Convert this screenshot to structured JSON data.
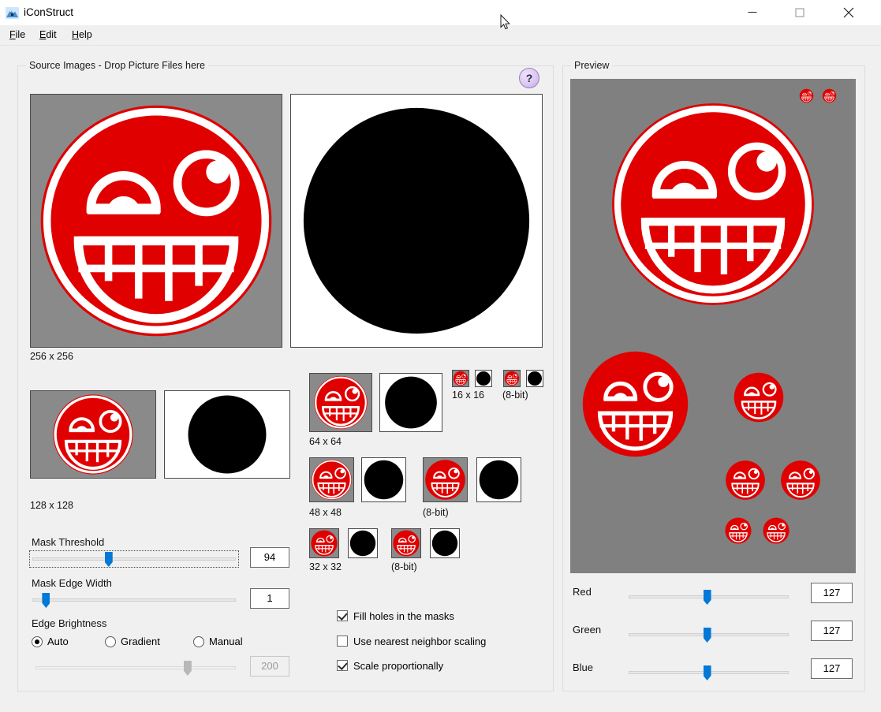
{
  "window": {
    "title": "iConStruct",
    "app_icon": "mountain-icon",
    "minimize_label": "Minimize",
    "maximize_label": "Maximize",
    "close_label": "Close"
  },
  "menu": [
    {
      "id": "file",
      "label": "File",
      "accel": "F"
    },
    {
      "id": "edit",
      "label": "Edit",
      "accel": "E"
    },
    {
      "id": "help",
      "label": "Help",
      "accel": "H"
    }
  ],
  "source_panel": {
    "title": "Source Images - Drop Picture Files here",
    "help_button": "?",
    "captions": {
      "c256": "256 x 256",
      "c128": "128 x 128",
      "c64": "64 x 64",
      "c48": "48 x 48",
      "c32": "32 x 32",
      "c16": "16 x 16",
      "bit48": "(8-bit)",
      "bit32": "(8-bit)",
      "bit16": "(8-bit)"
    }
  },
  "controls": {
    "mask_threshold": {
      "label": "Mask Threshold",
      "value": "94",
      "percent": 37,
      "focused": true
    },
    "mask_edge_width": {
      "label": "Mask Edge Width",
      "value": "1",
      "percent": 5
    },
    "edge_brightness": {
      "label": "Edge Brightness",
      "options": [
        {
          "id": "auto",
          "label": "Auto",
          "selected": true
        },
        {
          "id": "gradient",
          "label": "Gradient",
          "selected": false
        },
        {
          "id": "manual",
          "label": "Manual",
          "selected": false
        }
      ],
      "slider": {
        "value": "200",
        "percent": 77,
        "disabled": true
      }
    },
    "checkboxes": [
      {
        "id": "fill-holes",
        "label": "Fill holes in the masks",
        "checked": true
      },
      {
        "id": "nearest-neighbor",
        "label": "Use nearest neighbor scaling",
        "checked": false
      },
      {
        "id": "scale-proportionally",
        "label": "Scale proportionally",
        "checked": true
      }
    ]
  },
  "preview_panel": {
    "title": "Preview",
    "background_color": "#808080",
    "channels": [
      {
        "id": "red",
        "label": "Red",
        "value": "127",
        "percent": 49
      },
      {
        "id": "green",
        "label": "Green",
        "value": "127",
        "percent": 49
      },
      {
        "id": "blue",
        "label": "Blue",
        "value": "127",
        "percent": 49
      }
    ]
  },
  "colors": {
    "accent": "#0078d7",
    "face_red": "#e00000",
    "tile_gray": "#8a8a8a",
    "window_bg": "#f0f0f0",
    "help_purple": "#c4a8e2"
  }
}
